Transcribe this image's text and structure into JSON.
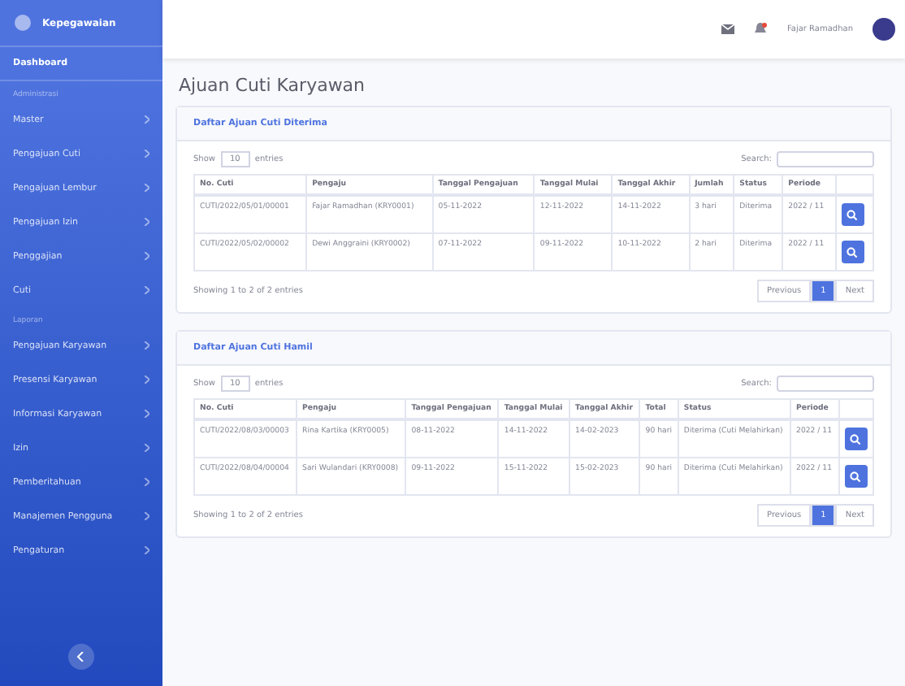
{
  "sidebar": {
    "brand": "Kepegawaian",
    "items": [
      {
        "label": "Dashboard",
        "kind": "link",
        "active": true
      },
      {
        "label": "Administrasi",
        "kind": "heading"
      },
      {
        "label": "Master",
        "kind": "menu"
      },
      {
        "label": "Pengajuan Cuti",
        "kind": "menu"
      },
      {
        "label": "Pengajuan Lembur",
        "kind": "menu"
      },
      {
        "label": "Pengajuan Izin",
        "kind": "menu"
      },
      {
        "label": "Penggajian",
        "kind": "menu"
      },
      {
        "label": "Cuti",
        "kind": "menu"
      },
      {
        "label": "Laporan",
        "kind": "heading"
      },
      {
        "label": "Pengajuan Karyawan",
        "kind": "menu"
      },
      {
        "label": "Presensi Karyawan",
        "kind": "menu"
      },
      {
        "label": "Informasi Karyawan",
        "kind": "menu"
      },
      {
        "label": "Izin",
        "kind": "menu"
      },
      {
        "label": "Pemberitahuan",
        "kind": "menu"
      },
      {
        "label": "Manajemen Pengguna",
        "kind": "menu"
      },
      {
        "label": "Pengaturan",
        "kind": "menu"
      }
    ]
  },
  "topbar": {
    "user": "Fajar Ramadhan"
  },
  "page_title": "Ajuan Cuti Karyawan",
  "cards": [
    {
      "title": "Daftar Ajuan Cuti Diterima",
      "show_label": "Show",
      "entries_label": "entries",
      "length": "10",
      "search_label": "Search:",
      "columns": [
        "No. Cuti",
        "Pengaju",
        "Tanggal Pengajuan",
        "Tanggal Mulai",
        "Tanggal Akhir",
        "Jumlah",
        "Status",
        "Periode"
      ],
      "rows": [
        [
          "CUTI/2022/05/01/00001",
          "Fajar Ramadhan (KRY0001)",
          "05-11-2022",
          "12-11-2022",
          "14-11-2022",
          "3 hari",
          "Diterima",
          "2022 / 11"
        ],
        [
          "CUTI/2022/05/02/00002",
          "Dewi Anggraini (KRY0002)",
          "07-11-2022",
          "09-11-2022",
          "10-11-2022",
          "2 hari",
          "Diterima",
          "2022 / 11"
        ]
      ],
      "info": "Showing 1 to 2 of 2 entries",
      "pages": [
        {
          "label": "Previous",
          "selected": false
        },
        {
          "label": "1",
          "selected": true
        },
        {
          "label": "Next",
          "selected": false
        }
      ]
    },
    {
      "title": "Daftar Ajuan Cuti Hamil",
      "show_label": "Show",
      "entries_label": "entries",
      "length": "10",
      "search_label": "Search:",
      "columns": [
        "No. Cuti",
        "Pengaju",
        "Tanggal Pengajuan",
        "Tanggal Mulai",
        "Tanggal Akhir",
        "Total",
        "Status",
        "Periode"
      ],
      "rows": [
        [
          "CUTI/2022/08/03/00003",
          "Rina Kartika (KRY0005)",
          "08-11-2022",
          "14-11-2022",
          "14-02-2023",
          "90 hari",
          "Diterima (Cuti Melahirkan)",
          "2022 / 11"
        ],
        [
          "CUTI/2022/08/04/00004",
          "Sari Wulandari (KRY0008)",
          "09-11-2022",
          "15-11-2022",
          "15-02-2023",
          "90 hari",
          "Diterima (Cuti Melahirkan)",
          "2022 / 11"
        ]
      ],
      "info": "Showing 1 to 2 of 2 entries",
      "pages": [
        {
          "label": "Previous",
          "selected": false
        },
        {
          "label": "1",
          "selected": true
        },
        {
          "label": "Next",
          "selected": false
        }
      ]
    }
  ]
}
